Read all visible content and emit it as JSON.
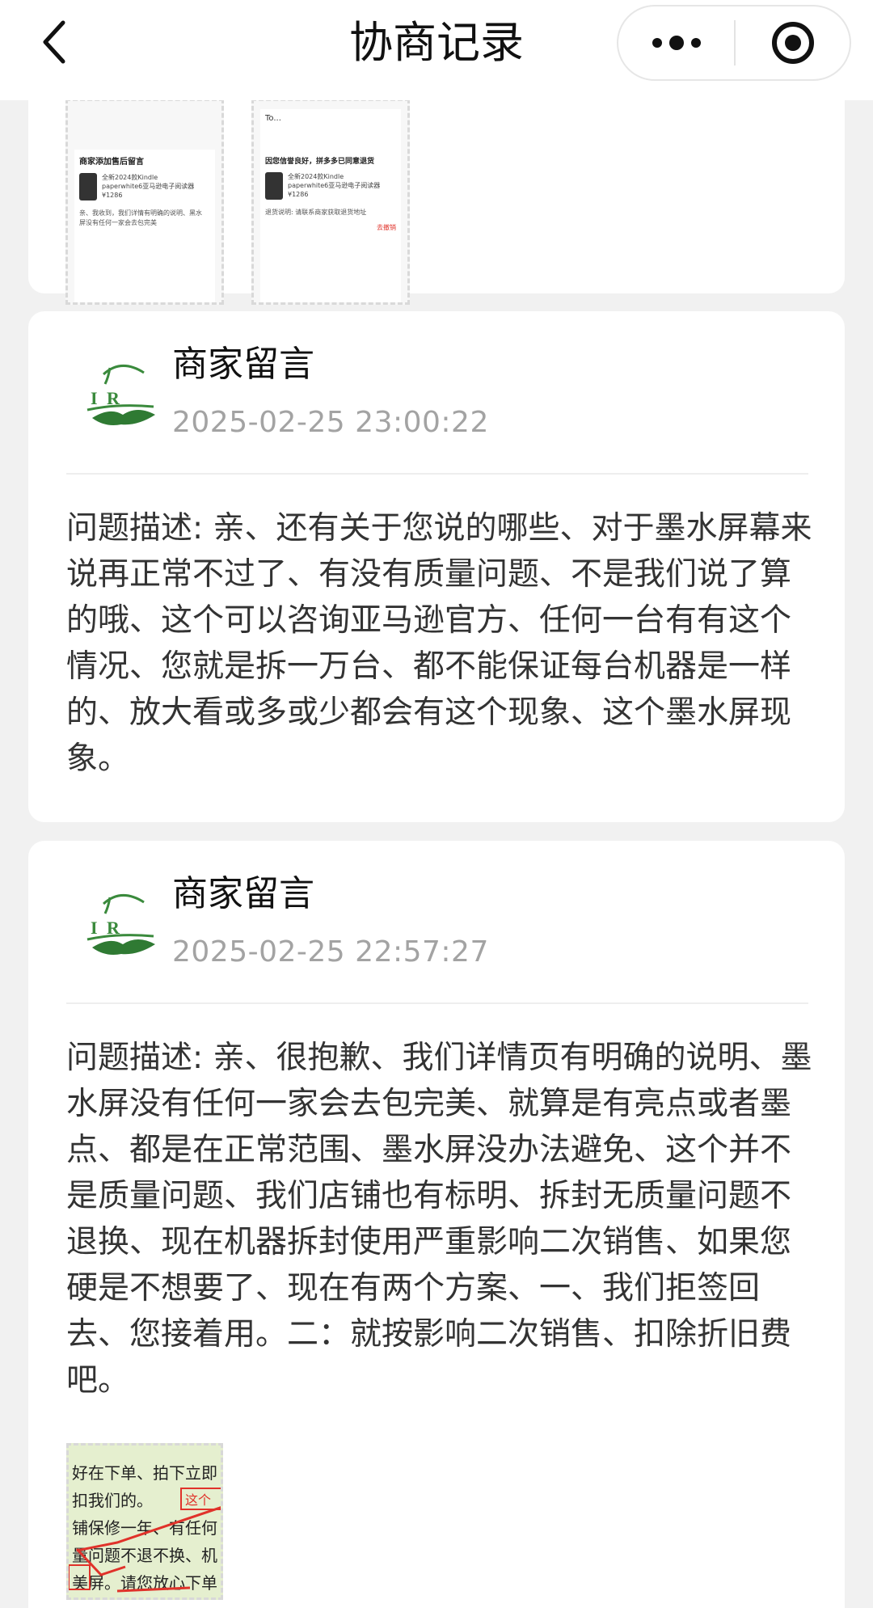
{
  "header": {
    "title": "协商记录",
    "back_icon": "chevron-left-icon",
    "more_icon": "more-dots-icon",
    "close_icon": "target-icon"
  },
  "attachments_top": [
    {
      "lines": [
        "商家添加售后留言",
        "全新2024款Kindle",
        "paperwhite6亚马逊电子阅读器",
        "¥1286",
        "亲、我收到，我们详情有明确的说明、黑水",
        "屏没有任何一家会去包完美"
      ]
    },
    {
      "lines": [
        "To...",
        "因您信誉良好，拼多多已同意退货",
        "全新2024款Kindle",
        "paperwhite6亚马逊电子阅读器",
        "¥1286",
        "退货说明: 请联系商家获取退货地址",
        "去撤销"
      ]
    }
  ],
  "messages": [
    {
      "sender": "商家留言",
      "time": "2025-02-25 23:00:22",
      "description": "问题描述: 亲、还有关于您说的哪些、对于墨水屏幕来说再正常不过了、有没有质量问题、不是我们说了算的哦、这个可以咨询亚马逊官方、任何一台有有这个情况、您就是拆一万台、都不能保证每台机器是一样的、放大看或多或少都会有这个现象、这个墨水屏现象。"
    },
    {
      "sender": "商家留言",
      "time": "2025-02-25 22:57:27",
      "description": "问题描述: 亲、很抱歉、我们详情页有明确的说明、墨水屏没有任何一家会去包完美、就算是有亮点或者墨点、都是在正常范围、墨水屏没办法避免、这个并不是质量问题、我们店铺也有标明、拆封无质量问题不退换、现在机器拆封使用严重影响二次销售、如果您硬是不想要了、现在有两个方案、一、我们拒签回去、您接着用。二：就按影响二次销售、扣除折旧费吧。",
      "attachment_lines": [
        "好在下单、拍下立即",
        "扣我们的。",
        "这个",
        "铺保修一年、有任何",
        "量问题不退不换、机",
        "美屏。请您放心下单"
      ]
    }
  ],
  "colors": {
    "background": "#f1f1f1",
    "card": "#ffffff",
    "timestamp": "#a3a3a3",
    "logo_green": "#3a8a3c",
    "annotation_red": "#e0322a"
  }
}
